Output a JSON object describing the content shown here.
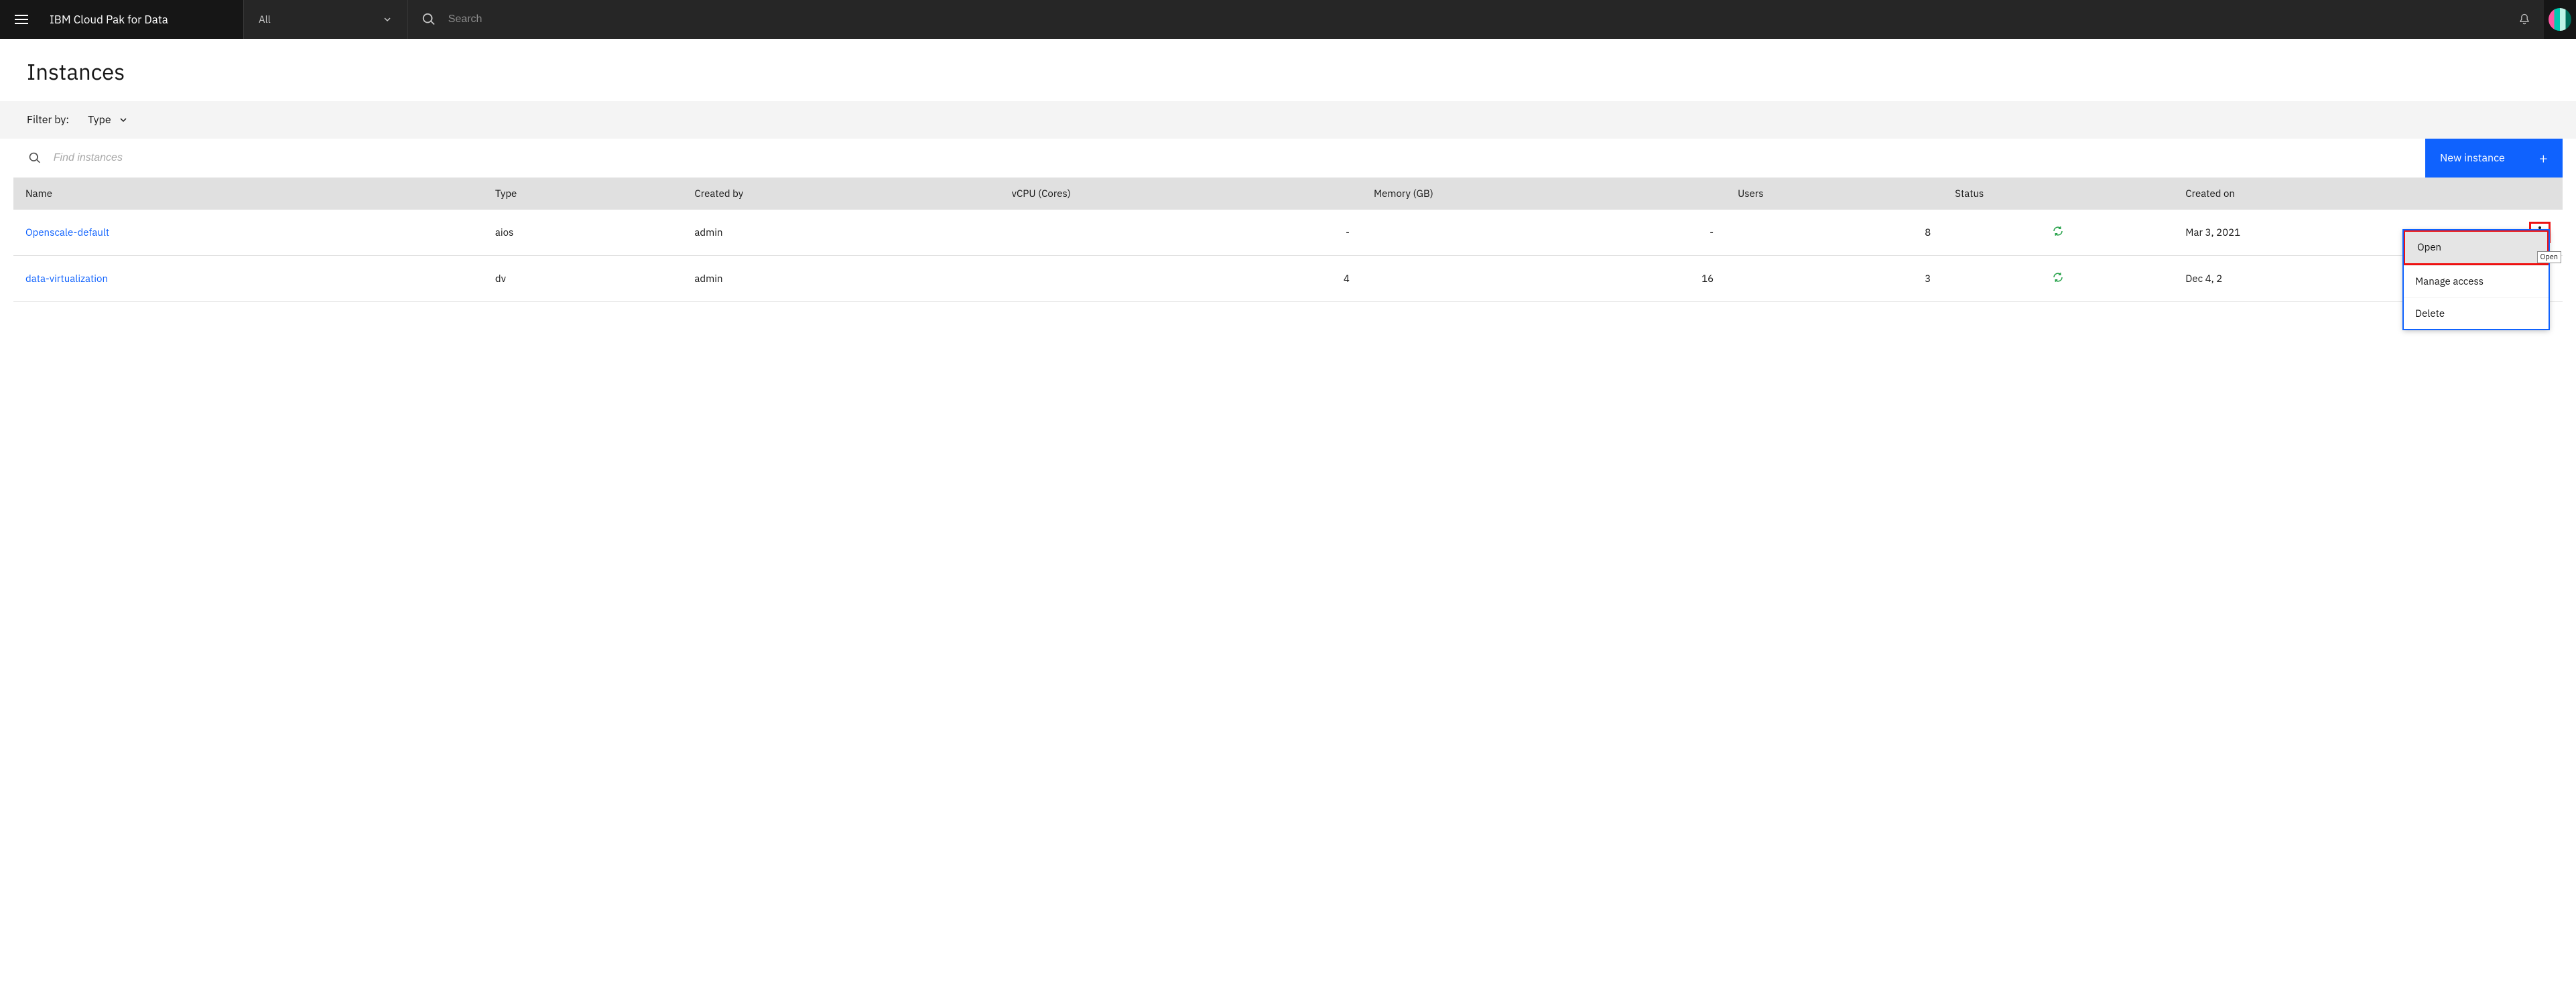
{
  "header": {
    "brand": "IBM Cloud Pak for Data",
    "scope_label": "All",
    "search_placeholder": "Search"
  },
  "page": {
    "title": "Instances"
  },
  "filter": {
    "label": "Filter by:",
    "type_label": "Type"
  },
  "toolbar": {
    "find_placeholder": "Find instances",
    "new_label": "New instance"
  },
  "table": {
    "columns": {
      "name": "Name",
      "type": "Type",
      "created_by": "Created by",
      "vcpu": "vCPU (Cores)",
      "memory": "Memory (GB)",
      "users": "Users",
      "status": "Status",
      "created_on": "Created on"
    },
    "rows": [
      {
        "name": "Openscale-default",
        "type": "aios",
        "created_by": "admin",
        "vcpu": "-",
        "memory": "-",
        "users": "8",
        "status": "running",
        "created_on": "Mar 3, 2021"
      },
      {
        "name": "data-virtualization",
        "type": "dv",
        "created_by": "admin",
        "vcpu": "4",
        "memory": "16",
        "users": "3",
        "status": "running",
        "created_on": "Dec 4, 2"
      }
    ]
  },
  "menu": {
    "open": "Open",
    "manage": "Manage access",
    "delete": "Delete",
    "tooltip": "Open"
  }
}
